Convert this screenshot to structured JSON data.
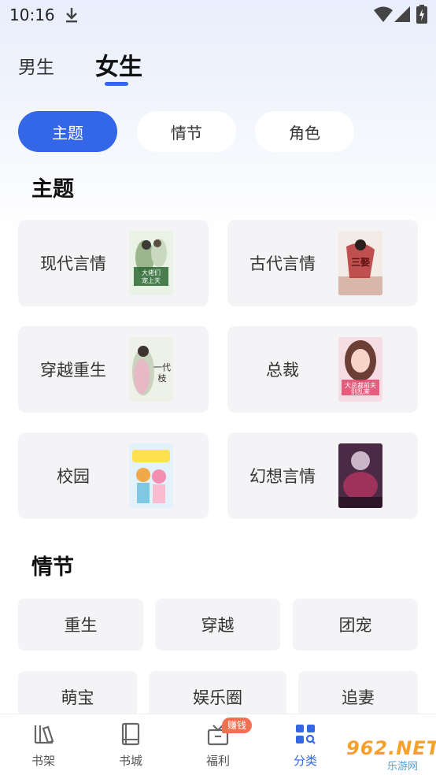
{
  "status_bar": {
    "time": "10:16"
  },
  "gender_tabs": {
    "male": "男生",
    "female": "女生"
  },
  "chips": [
    "主题",
    "情节",
    "角色"
  ],
  "sections": {
    "theme": "主题",
    "plot": "情节"
  },
  "themes": [
    {
      "label": "现代言情",
      "cover_text": "大佬们宠上天"
    },
    {
      "label": "古代言情",
      "cover_text": "三娶半"
    },
    {
      "label": "穿越重生",
      "cover_text": "一代枝"
    },
    {
      "label": "总裁",
      "cover_text": "大总裁前夫别乱来"
    },
    {
      "label": "校园",
      "cover_text": ""
    },
    {
      "label": "幻想言情",
      "cover_text": ""
    }
  ],
  "plots": [
    "重生",
    "穿越",
    "团宠",
    "萌宝",
    "娱乐圈",
    "追妻"
  ],
  "bottom_nav": [
    {
      "label": "书架",
      "icon": "bookshelf-icon"
    },
    {
      "label": "书城",
      "icon": "book-store-icon"
    },
    {
      "label": "福利",
      "icon": "gift-icon"
    },
    {
      "label": "分类",
      "icon": "category-icon"
    }
  ],
  "earn_badge": "赚钱",
  "watermark": {
    "text": "962.NET",
    "sub": "乐游网"
  },
  "colors": {
    "accent": "#3467e8",
    "badge": "#f36f52"
  }
}
